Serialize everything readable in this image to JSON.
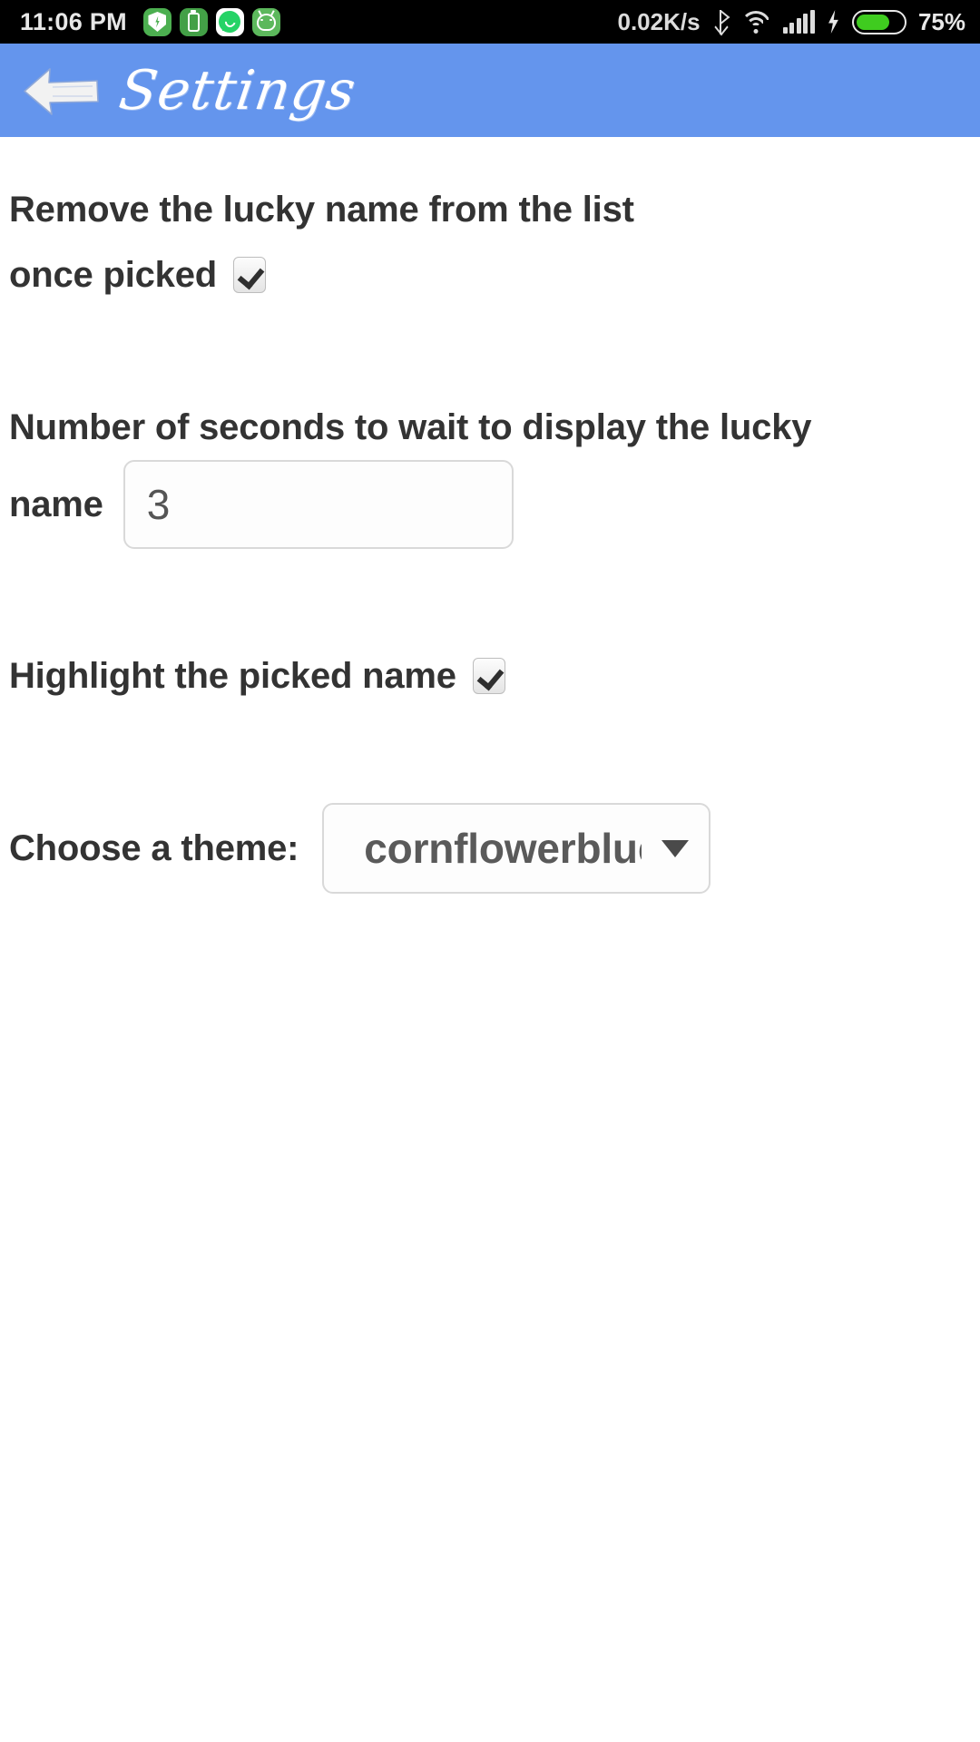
{
  "status_bar": {
    "clock": "11:06 PM",
    "network_speed": "0.02K/s",
    "battery_percent": "75%",
    "left_icons": [
      "battery-saver-shield-icon",
      "battery-app-icon",
      "whatsapp-icon",
      "android-app-icon"
    ],
    "right_icons": [
      "bluetooth-icon",
      "wifi-icon",
      "cellular-signal-icon",
      "charging-bolt-icon",
      "battery-icon"
    ],
    "background": "#000000",
    "text_color": "#e8e8e8",
    "battery_fill_color": "#3fcc1f"
  },
  "header": {
    "title": "Settings",
    "back_icon": "back-arrow-icon",
    "background": "#6495ed",
    "text_color": "#ffffff"
  },
  "settings": {
    "remove_lucky_name": {
      "label_line1": "Remove the lucky name from the list",
      "label_line2": "once picked",
      "checked": true,
      "checkbox_icon": "checkmark-icon"
    },
    "wait_seconds": {
      "label_line1": "Number of seconds to wait to display the lucky",
      "label_line2": "name",
      "value": "3",
      "placeholder": "3"
    },
    "highlight_picked": {
      "label": "Highlight the picked name",
      "checked": true,
      "checkbox_icon": "checkmark-icon"
    },
    "theme": {
      "label": "Choose a theme:",
      "selected": "cornflowerblue",
      "caret_icon": "chevron-down-icon",
      "options": [
        "cornflowerblue"
      ]
    }
  }
}
